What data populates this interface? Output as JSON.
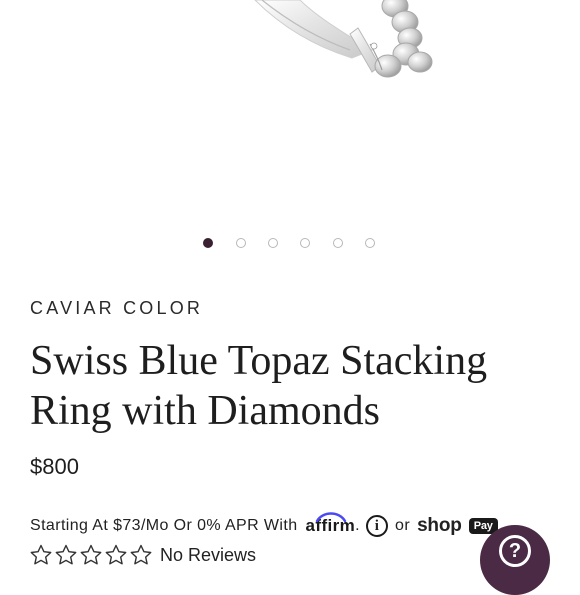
{
  "product": {
    "brand": "CAVIAR COLOR",
    "title": "Swiss Blue Topaz Stacking Ring with Diamonds",
    "price": "$800",
    "image": {
      "icon": "ring-product-image"
    }
  },
  "carousel": {
    "total_slides": 6,
    "active_index": 0
  },
  "financing": {
    "text": "Starting At $73/Mo Or 0% APR With",
    "affirm_label": "affirm",
    "dot": ".",
    "info_icon": "i",
    "or_text": "or",
    "shop_label": "shop",
    "pay_label": "Pay"
  },
  "reviews": {
    "stars_filled": 0,
    "stars_total": 5,
    "label": "No Reviews"
  },
  "help_button": {
    "icon": "question-mark-icon",
    "glyph": "?"
  },
  "colors": {
    "accent": "#4a2a44",
    "active_dot": "#3a2030",
    "text": "#1e1e1e"
  }
}
